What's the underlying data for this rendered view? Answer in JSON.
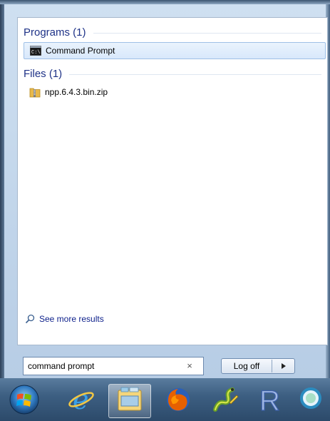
{
  "results": {
    "programs_header": "Programs (1)",
    "program_items": [
      {
        "label": "Command Prompt",
        "icon": "cmd-icon"
      }
    ],
    "files_header": "Files (1)",
    "file_items": [
      {
        "label": "npp.6.4.3.bin.zip",
        "icon": "zip-folder-icon"
      }
    ],
    "see_more_label": "See more results"
  },
  "search": {
    "value": "command prompt",
    "clear_glyph": "×"
  },
  "power": {
    "logoff_label": "Log off",
    "arrow_glyph": "▸"
  },
  "taskbar": {
    "items": [
      {
        "icon": "windows-start-orb-icon"
      },
      {
        "icon": "internet-explorer-icon"
      },
      {
        "icon": "file-explorer-icon"
      },
      {
        "icon": "firefox-icon"
      },
      {
        "icon": "python-idle-icon"
      },
      {
        "icon": "r-icon"
      },
      {
        "icon": "search-magnifier-icon"
      }
    ]
  },
  "colors": {
    "group_header": "#1e3287",
    "link": "#0b1e8a",
    "selection": "#d8e8fb",
    "taskbar": "#3d5f82"
  }
}
